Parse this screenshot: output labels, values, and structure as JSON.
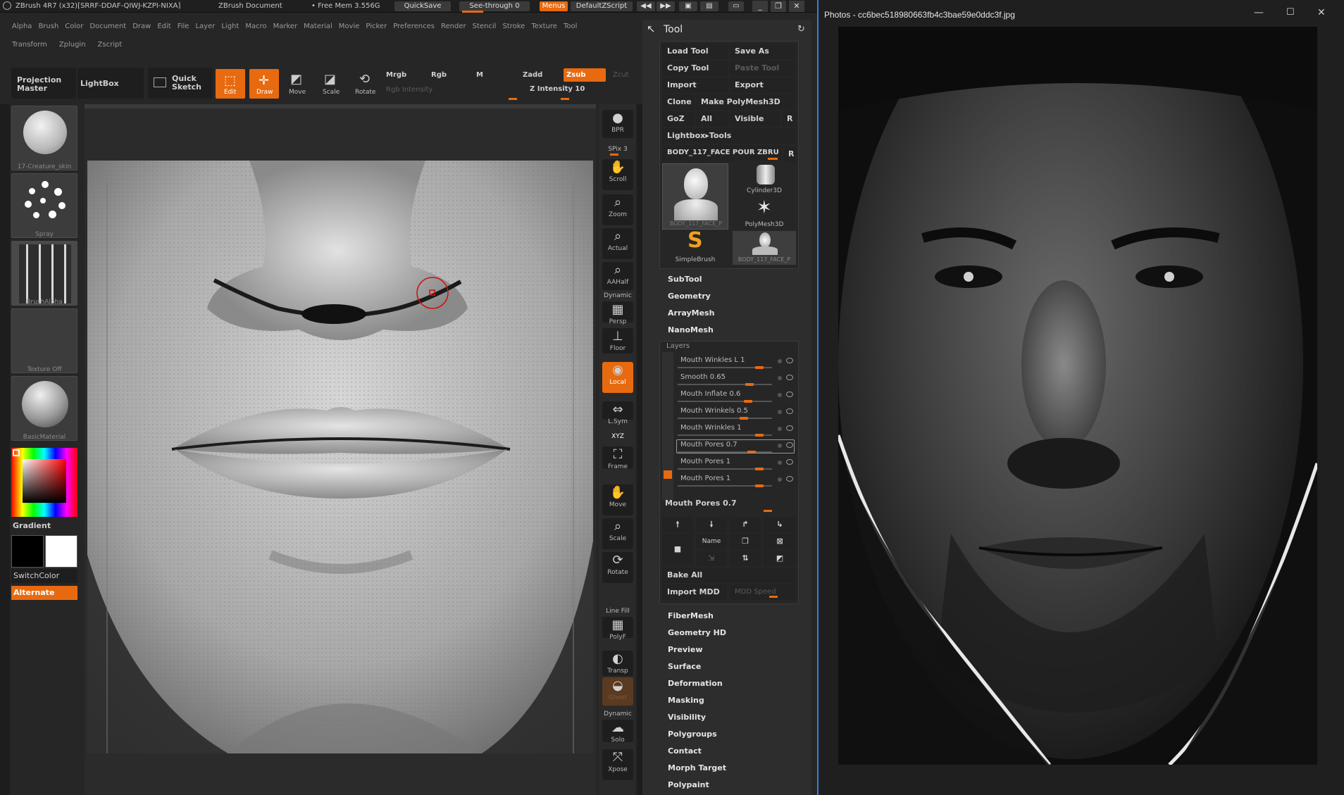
{
  "zbrush": {
    "title_left": "ZBrush 4R7 (x32)[SRRF-DDAF-QIWJ-KZPI-NIXA]",
    "title_doc": "ZBrush Document",
    "free_mem": "• Free Mem 3.556G",
    "quicksave": "QuickSave",
    "see_through": "See-through",
    "see_through_value": "0",
    "menus": "Menus",
    "default_script": "DefaultZScript",
    "menu_row1": [
      "Alpha",
      "Brush",
      "Color",
      "Document",
      "Draw",
      "Edit",
      "File",
      "Layer",
      "Light",
      "Macro",
      "Marker",
      "Material",
      "Movie",
      "Picker",
      "Preferences",
      "Render",
      "Stencil",
      "Stroke",
      "Texture",
      "Tool"
    ],
    "menu_row2": [
      "Transform",
      "Zplugin",
      "Zscript"
    ],
    "toolbar": {
      "projection_master": "Projection Master",
      "lightbox": "LightBox",
      "quick_sketch": "Quick Sketch",
      "edit": "Edit",
      "draw": "Draw",
      "move": "Move",
      "scale": "Scale",
      "rotate": "Rotate",
      "mrgb": "Mrgb",
      "rgb": "Rgb",
      "m": "M",
      "zadd": "Zadd",
      "zsub": "Zsub",
      "zcut": "Zcut",
      "rgb_intensity": "Rgb Intensity",
      "z_intensity": "Z Intensity 10"
    },
    "left_tray": {
      "brush_label": "17-Creature_skin",
      "stroke_label": "Spray",
      "alpha_label": "BrushAlpha",
      "texture_label": "Texture Off",
      "material_label": "BasicMaterial",
      "gradient": "Gradient",
      "switch_color": "SwitchColor",
      "alternate": "Alternate"
    },
    "shelf": [
      {
        "label": "BPR",
        "icon": "bpr-icon"
      },
      {
        "label": "SPix 3",
        "icon": ""
      },
      {
        "label": "Scroll",
        "icon": "scroll-icon"
      },
      {
        "label": "Zoom",
        "icon": "zoom-icon"
      },
      {
        "label": "Actual",
        "icon": "actual-icon"
      },
      {
        "label": "AAHalf",
        "icon": "aahalf-icon"
      },
      {
        "label": "Dynamic",
        "icon": ""
      },
      {
        "label": "Persp",
        "icon": "persp-icon"
      },
      {
        "label": "Floor",
        "icon": "floor-icon"
      },
      {
        "label": "Local",
        "icon": "local-icon"
      },
      {
        "label": "L.Sym",
        "icon": "lsym-icon"
      },
      {
        "label": "XYZ",
        "icon": ""
      },
      {
        "label": "Frame",
        "icon": "frame-icon"
      },
      {
        "label": "Move",
        "icon": "move-icon"
      },
      {
        "label": "Scale",
        "icon": "scale-icon"
      },
      {
        "label": "Rotate",
        "icon": "rotate-icon"
      },
      {
        "label": "Line Fill",
        "icon": ""
      },
      {
        "label": "PolyF",
        "icon": "polyf-icon"
      },
      {
        "label": "Transp",
        "icon": "transp-icon"
      },
      {
        "label": "Ghost",
        "icon": "ghost-icon"
      },
      {
        "label": "Dynamic",
        "icon": ""
      },
      {
        "label": "Solo",
        "icon": "solo-icon"
      },
      {
        "label": "Xpose",
        "icon": "xpose-icon"
      }
    ],
    "tool_panel": {
      "title": "Tool",
      "load_tool": "Load Tool",
      "save_as": "Save As",
      "copy_tool": "Copy Tool",
      "paste_tool": "Paste Tool",
      "import": "Import",
      "export": "Export",
      "clone": "Clone",
      "make_polymesh": "Make PolyMesh3D",
      "goz": "GoZ",
      "all": "All",
      "visible": "Visible",
      "r": "R",
      "lightbox_tools": "Lightbox▸Tools",
      "current_tool": "BODY_117_FACE POUR ZBRU",
      "thumbs": [
        "BODY_117_FACE_P",
        "Cylinder3D",
        "PolyMesh3D",
        "SimpleBrush",
        "BODY_117_FACE_P"
      ],
      "sections_top": [
        "SubTool",
        "Geometry",
        "ArrayMesh",
        "NanoMesh"
      ],
      "layers_title": "Layers",
      "layers": [
        {
          "name": "Mouth Winkles L 1",
          "knob": 0.82
        },
        {
          "name": "Smooth 0.65",
          "knob": 0.72
        },
        {
          "name": "Mouth Inflate 0.6",
          "knob": 0.7
        },
        {
          "name": "Mouth Wrinkels 0.5",
          "knob": 0.66
        },
        {
          "name": "Mouth Wrinkles 1",
          "knob": 0.82
        },
        {
          "name": "Mouth Pores 0.7",
          "knob": 0.74
        },
        {
          "name": "Mouth Pores 1",
          "knob": 0.82
        },
        {
          "name": "Mouth Pores 1",
          "knob": 0.82
        }
      ],
      "active_layer_value": "Mouth Pores 0.7",
      "name_btn": "Name",
      "bake_all": "Bake All",
      "import_mdd": "Import MDD",
      "mdd_speed": "MDD Speed",
      "sections_bottom": [
        "FiberMesh",
        "Geometry HD",
        "Preview",
        "Surface",
        "Deformation",
        "Masking",
        "Visibility",
        "Polygroups",
        "Contact",
        "Morph Target",
        "Polypaint"
      ]
    }
  },
  "photos": {
    "title": "Photos - cc6bec518980663fb4c3bae59e0ddc3f.jpg"
  },
  "colors": {
    "accent": "#e86a10",
    "window_border": "#3a7fcf"
  }
}
